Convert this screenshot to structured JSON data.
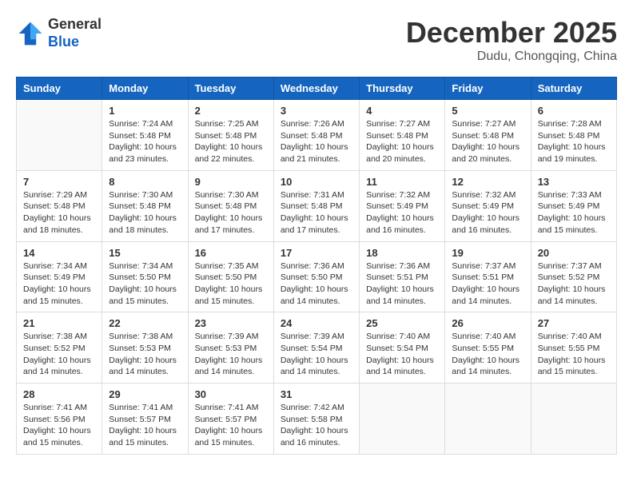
{
  "header": {
    "logo_general": "General",
    "logo_blue": "Blue",
    "month": "December 2025",
    "location": "Dudu, Chongqing, China"
  },
  "weekdays": [
    "Sunday",
    "Monday",
    "Tuesday",
    "Wednesday",
    "Thursday",
    "Friday",
    "Saturday"
  ],
  "weeks": [
    [
      {
        "day": "",
        "sunrise": "",
        "sunset": "",
        "daylight": ""
      },
      {
        "day": "1",
        "sunrise": "Sunrise: 7:24 AM",
        "sunset": "Sunset: 5:48 PM",
        "daylight": "Daylight: 10 hours and 23 minutes."
      },
      {
        "day": "2",
        "sunrise": "Sunrise: 7:25 AM",
        "sunset": "Sunset: 5:48 PM",
        "daylight": "Daylight: 10 hours and 22 minutes."
      },
      {
        "day": "3",
        "sunrise": "Sunrise: 7:26 AM",
        "sunset": "Sunset: 5:48 PM",
        "daylight": "Daylight: 10 hours and 21 minutes."
      },
      {
        "day": "4",
        "sunrise": "Sunrise: 7:27 AM",
        "sunset": "Sunset: 5:48 PM",
        "daylight": "Daylight: 10 hours and 20 minutes."
      },
      {
        "day": "5",
        "sunrise": "Sunrise: 7:27 AM",
        "sunset": "Sunset: 5:48 PM",
        "daylight": "Daylight: 10 hours and 20 minutes."
      },
      {
        "day": "6",
        "sunrise": "Sunrise: 7:28 AM",
        "sunset": "Sunset: 5:48 PM",
        "daylight": "Daylight: 10 hours and 19 minutes."
      }
    ],
    [
      {
        "day": "7",
        "sunrise": "Sunrise: 7:29 AM",
        "sunset": "Sunset: 5:48 PM",
        "daylight": "Daylight: 10 hours and 18 minutes."
      },
      {
        "day": "8",
        "sunrise": "Sunrise: 7:30 AM",
        "sunset": "Sunset: 5:48 PM",
        "daylight": "Daylight: 10 hours and 18 minutes."
      },
      {
        "day": "9",
        "sunrise": "Sunrise: 7:30 AM",
        "sunset": "Sunset: 5:48 PM",
        "daylight": "Daylight: 10 hours and 17 minutes."
      },
      {
        "day": "10",
        "sunrise": "Sunrise: 7:31 AM",
        "sunset": "Sunset: 5:48 PM",
        "daylight": "Daylight: 10 hours and 17 minutes."
      },
      {
        "day": "11",
        "sunrise": "Sunrise: 7:32 AM",
        "sunset": "Sunset: 5:49 PM",
        "daylight": "Daylight: 10 hours and 16 minutes."
      },
      {
        "day": "12",
        "sunrise": "Sunrise: 7:32 AM",
        "sunset": "Sunset: 5:49 PM",
        "daylight": "Daylight: 10 hours and 16 minutes."
      },
      {
        "day": "13",
        "sunrise": "Sunrise: 7:33 AM",
        "sunset": "Sunset: 5:49 PM",
        "daylight": "Daylight: 10 hours and 15 minutes."
      }
    ],
    [
      {
        "day": "14",
        "sunrise": "Sunrise: 7:34 AM",
        "sunset": "Sunset: 5:49 PM",
        "daylight": "Daylight: 10 hours and 15 minutes."
      },
      {
        "day": "15",
        "sunrise": "Sunrise: 7:34 AM",
        "sunset": "Sunset: 5:50 PM",
        "daylight": "Daylight: 10 hours and 15 minutes."
      },
      {
        "day": "16",
        "sunrise": "Sunrise: 7:35 AM",
        "sunset": "Sunset: 5:50 PM",
        "daylight": "Daylight: 10 hours and 15 minutes."
      },
      {
        "day": "17",
        "sunrise": "Sunrise: 7:36 AM",
        "sunset": "Sunset: 5:50 PM",
        "daylight": "Daylight: 10 hours and 14 minutes."
      },
      {
        "day": "18",
        "sunrise": "Sunrise: 7:36 AM",
        "sunset": "Sunset: 5:51 PM",
        "daylight": "Daylight: 10 hours and 14 minutes."
      },
      {
        "day": "19",
        "sunrise": "Sunrise: 7:37 AM",
        "sunset": "Sunset: 5:51 PM",
        "daylight": "Daylight: 10 hours and 14 minutes."
      },
      {
        "day": "20",
        "sunrise": "Sunrise: 7:37 AM",
        "sunset": "Sunset: 5:52 PM",
        "daylight": "Daylight: 10 hours and 14 minutes."
      }
    ],
    [
      {
        "day": "21",
        "sunrise": "Sunrise: 7:38 AM",
        "sunset": "Sunset: 5:52 PM",
        "daylight": "Daylight: 10 hours and 14 minutes."
      },
      {
        "day": "22",
        "sunrise": "Sunrise: 7:38 AM",
        "sunset": "Sunset: 5:53 PM",
        "daylight": "Daylight: 10 hours and 14 minutes."
      },
      {
        "day": "23",
        "sunrise": "Sunrise: 7:39 AM",
        "sunset": "Sunset: 5:53 PM",
        "daylight": "Daylight: 10 hours and 14 minutes."
      },
      {
        "day": "24",
        "sunrise": "Sunrise: 7:39 AM",
        "sunset": "Sunset: 5:54 PM",
        "daylight": "Daylight: 10 hours and 14 minutes."
      },
      {
        "day": "25",
        "sunrise": "Sunrise: 7:40 AM",
        "sunset": "Sunset: 5:54 PM",
        "daylight": "Daylight: 10 hours and 14 minutes."
      },
      {
        "day": "26",
        "sunrise": "Sunrise: 7:40 AM",
        "sunset": "Sunset: 5:55 PM",
        "daylight": "Daylight: 10 hours and 14 minutes."
      },
      {
        "day": "27",
        "sunrise": "Sunrise: 7:40 AM",
        "sunset": "Sunset: 5:55 PM",
        "daylight": "Daylight: 10 hours and 15 minutes."
      }
    ],
    [
      {
        "day": "28",
        "sunrise": "Sunrise: 7:41 AM",
        "sunset": "Sunset: 5:56 PM",
        "daylight": "Daylight: 10 hours and 15 minutes."
      },
      {
        "day": "29",
        "sunrise": "Sunrise: 7:41 AM",
        "sunset": "Sunset: 5:57 PM",
        "daylight": "Daylight: 10 hours and 15 minutes."
      },
      {
        "day": "30",
        "sunrise": "Sunrise: 7:41 AM",
        "sunset": "Sunset: 5:57 PM",
        "daylight": "Daylight: 10 hours and 15 minutes."
      },
      {
        "day": "31",
        "sunrise": "Sunrise: 7:42 AM",
        "sunset": "Sunset: 5:58 PM",
        "daylight": "Daylight: 10 hours and 16 minutes."
      },
      {
        "day": "",
        "sunrise": "",
        "sunset": "",
        "daylight": ""
      },
      {
        "day": "",
        "sunrise": "",
        "sunset": "",
        "daylight": ""
      },
      {
        "day": "",
        "sunrise": "",
        "sunset": "",
        "daylight": ""
      }
    ]
  ]
}
